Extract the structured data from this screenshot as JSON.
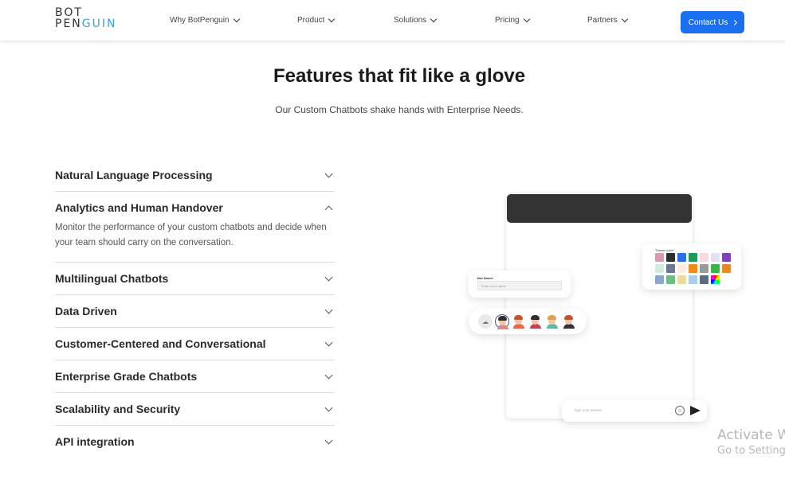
{
  "nav": {
    "logo_line1": "BOT",
    "logo_line2_a": "PEN",
    "logo_line2_b": "GUIN",
    "items": [
      {
        "label": "Why BotPenguin"
      },
      {
        "label": "Product"
      },
      {
        "label": "Solutions"
      },
      {
        "label": "Pricing"
      },
      {
        "label": "Partners"
      }
    ],
    "contact_label": "Contact Us"
  },
  "hero": {
    "title": "Features that fit like a glove",
    "subtitle": "Our Custom Chatbots shake hands with Enterprise Needs."
  },
  "features": [
    {
      "title": "Natural Language Processing",
      "expanded": false
    },
    {
      "title": "Analytics and Human Handover",
      "expanded": true,
      "body": "Monitor the performance of your custom chatbots and decide when your team should carry on the conversation."
    },
    {
      "title": "Multilingual Chatbots",
      "expanded": false
    },
    {
      "title": "Data Driven",
      "expanded": false
    },
    {
      "title": "Customer-Centered and Conversational",
      "expanded": false
    },
    {
      "title": "Enterprise Grade Chatbots",
      "expanded": false
    },
    {
      "title": "Scalability and Security",
      "expanded": false
    },
    {
      "title": "API integration",
      "expanded": false
    }
  ],
  "mockup": {
    "bot_name_label": "Bot Name*",
    "bot_name_placeholder": "Enter a bot name",
    "theme_label": "Theme color*",
    "theme_colors": [
      "#d99aae",
      "#2f2f2f",
      "#2b6fe8",
      "#1d9a5c",
      "#f7dbe0",
      "#e4e2f2",
      "#7b45b8",
      "#d4ecdf",
      "#6c7891",
      "#fdebe4",
      "#f08a1c",
      "#9a9a9a",
      "#3bb54a",
      "#e08a2a",
      "#8fa6cc",
      "#6ebc86",
      "#e7dda0",
      "#a9cdea",
      "#5c6b80",
      "rainbow"
    ],
    "chat_placeholder": "Type your answer",
    "emoji_glyph": "☺"
  },
  "watermark": {
    "line1": "Activate Windows",
    "line2": "Go to Settings to activate Windows."
  }
}
